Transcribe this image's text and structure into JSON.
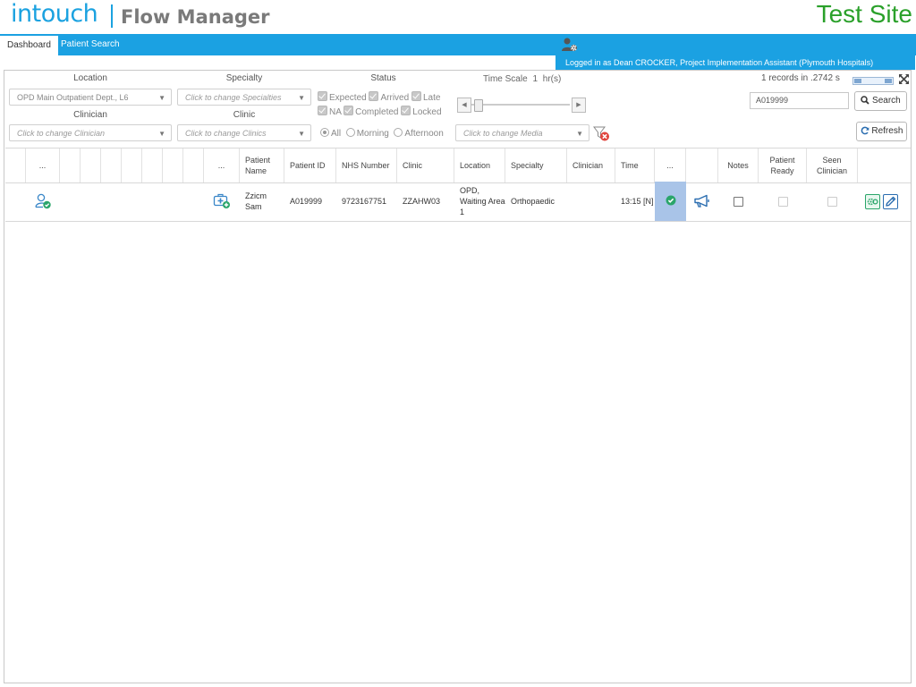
{
  "header": {
    "logo_text": "intouch",
    "app_name": "Flow Manager",
    "site_label": "Test Site",
    "login_text": "Logged in as Dean CROCKER, Project Implementation Assistant (Plymouth Hospitals)"
  },
  "tabs": [
    {
      "label": "Dashboard",
      "active": true
    },
    {
      "label": "Patient Search",
      "active": false
    }
  ],
  "filters": {
    "location_label": "Location",
    "location_value": "OPD Main Outpatient Dept., L6",
    "specialty_label": "Specialty",
    "specialty_placeholder": "Click to change Specialties",
    "clinician_label": "Clinician",
    "clinician_placeholder": "Click to change Clinician",
    "clinic_label": "Clinic",
    "clinic_placeholder": "Click to change Clinics",
    "status_label": "Status",
    "status_options": [
      "Expected",
      "Arrived",
      "Late",
      "NA",
      "Completed",
      "Locked"
    ],
    "session_options": [
      "All",
      "Morning",
      "Afternoon"
    ],
    "media_placeholder": "Click to change Media",
    "time_scale_label": "Time Scale",
    "time_scale_value": "1",
    "time_scale_unit": "hr(s)"
  },
  "records_info": "1 records in .2742 s",
  "search": {
    "value": "A019999",
    "button_label": "Search"
  },
  "refresh_label": "Refresh",
  "table": {
    "headers": {
      "col_more1": "...",
      "col_more2": "...",
      "patient_name": "Patient Name",
      "patient_id": "Patient ID",
      "nhs_number": "NHS Number",
      "clinic": "Clinic",
      "location": "Location",
      "specialty": "Specialty",
      "clinician": "Clinician",
      "time": "Time",
      "col_more3": "...",
      "notes": "Notes",
      "patient_ready": "Patient Ready",
      "seen_clinician": "Seen Clinician"
    },
    "rows": [
      {
        "patient_name": "Zzicm Sam",
        "patient_id": "A019999",
        "nhs_number": "9723167751",
        "clinic": "ZZAHW03",
        "location": "OPD, Waiting Area 1",
        "specialty": "Orthopaedic",
        "clinician": "",
        "time": "13:15 [N]"
      }
    ]
  },
  "colors": {
    "brand_blue": "#1ba1e2",
    "test_site_green": "#2aa02a",
    "status_cell": "#a9c4e8",
    "check_green": "#2aa56a"
  },
  "icons": [
    "user-check-icon",
    "medical-kit-add-icon",
    "check-circle-icon",
    "megaphone-icon",
    "gear-icon",
    "pencil-icon",
    "filter-clear-icon",
    "fullscreen-icon",
    "refresh-icon",
    "search-icon",
    "user-gear-icon"
  ]
}
